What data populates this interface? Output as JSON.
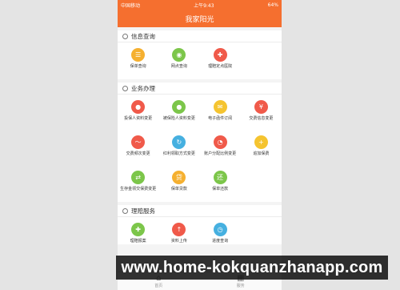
{
  "status_bar": {
    "carrier": "中国移动",
    "time": "上午9:43",
    "battery": "64%"
  },
  "nav": {
    "title": "我家阳光"
  },
  "sections": [
    {
      "title": "信息查询",
      "items": [
        {
          "label": "保单查询",
          "icon": "list-icon",
          "color": "#f5b030",
          "glyph": "☰"
        },
        {
          "label": "网点查询",
          "icon": "location-pin-icon",
          "color": "#7cc64a",
          "glyph": "◉"
        },
        {
          "label": "理赔定点医院",
          "icon": "hospital-icon",
          "color": "#f05a4a",
          "glyph": "✚"
        }
      ]
    },
    {
      "title": "业务办理",
      "items": [
        {
          "label": "投保人资料变更",
          "icon": "person-icon",
          "color": "#f05a4a",
          "glyph": "●"
        },
        {
          "label": "被保险人资料变更",
          "icon": "person-icon",
          "color": "#7cc64a",
          "glyph": "●"
        },
        {
          "label": "电子函件订阅",
          "icon": "mail-icon",
          "color": "#f5c430",
          "glyph": "✉"
        },
        {
          "label": "交费信息变更",
          "icon": "yuan-icon",
          "color": "#f05a4a",
          "glyph": "¥"
        },
        {
          "label": "交费频次变更",
          "icon": "trend-icon",
          "color": "#f05a4a",
          "glyph": "〜"
        },
        {
          "label": "红利领取方式变更",
          "icon": "refresh-icon",
          "color": "#46b0e0",
          "glyph": "↻"
        },
        {
          "label": "账户分配比例变更",
          "icon": "pie-chart-icon",
          "color": "#f05a4a",
          "glyph": "◔"
        },
        {
          "label": "追加保费",
          "icon": "plus-icon",
          "color": "#f5c430",
          "glyph": "+"
        },
        {
          "label": "生存金领交保费变更",
          "icon": "exchange-icon",
          "color": "#7cc64a",
          "glyph": "⇄"
        },
        {
          "label": "保单贷款",
          "icon": "loan-icon",
          "color": "#f5b030",
          "glyph": "贷"
        },
        {
          "label": "保单还款",
          "icon": "repay-icon",
          "color": "#7cc64a",
          "glyph": "还"
        }
      ]
    },
    {
      "title": "理赔服务",
      "items": [
        {
          "label": "理赔报案",
          "icon": "shield-plus-icon",
          "color": "#7cc64a",
          "glyph": "✚"
        },
        {
          "label": "资料上传",
          "icon": "upload-icon",
          "color": "#f05a4a",
          "glyph": "↑"
        },
        {
          "label": "进度查询",
          "icon": "clock-icon",
          "color": "#46b0e0",
          "glyph": "◷"
        }
      ]
    }
  ],
  "tabbar": {
    "tabs": [
      {
        "label": "首页"
      },
      {
        "label": "服务"
      }
    ]
  },
  "watermark": {
    "text": "www.home-kokquanzhanapp.com"
  }
}
